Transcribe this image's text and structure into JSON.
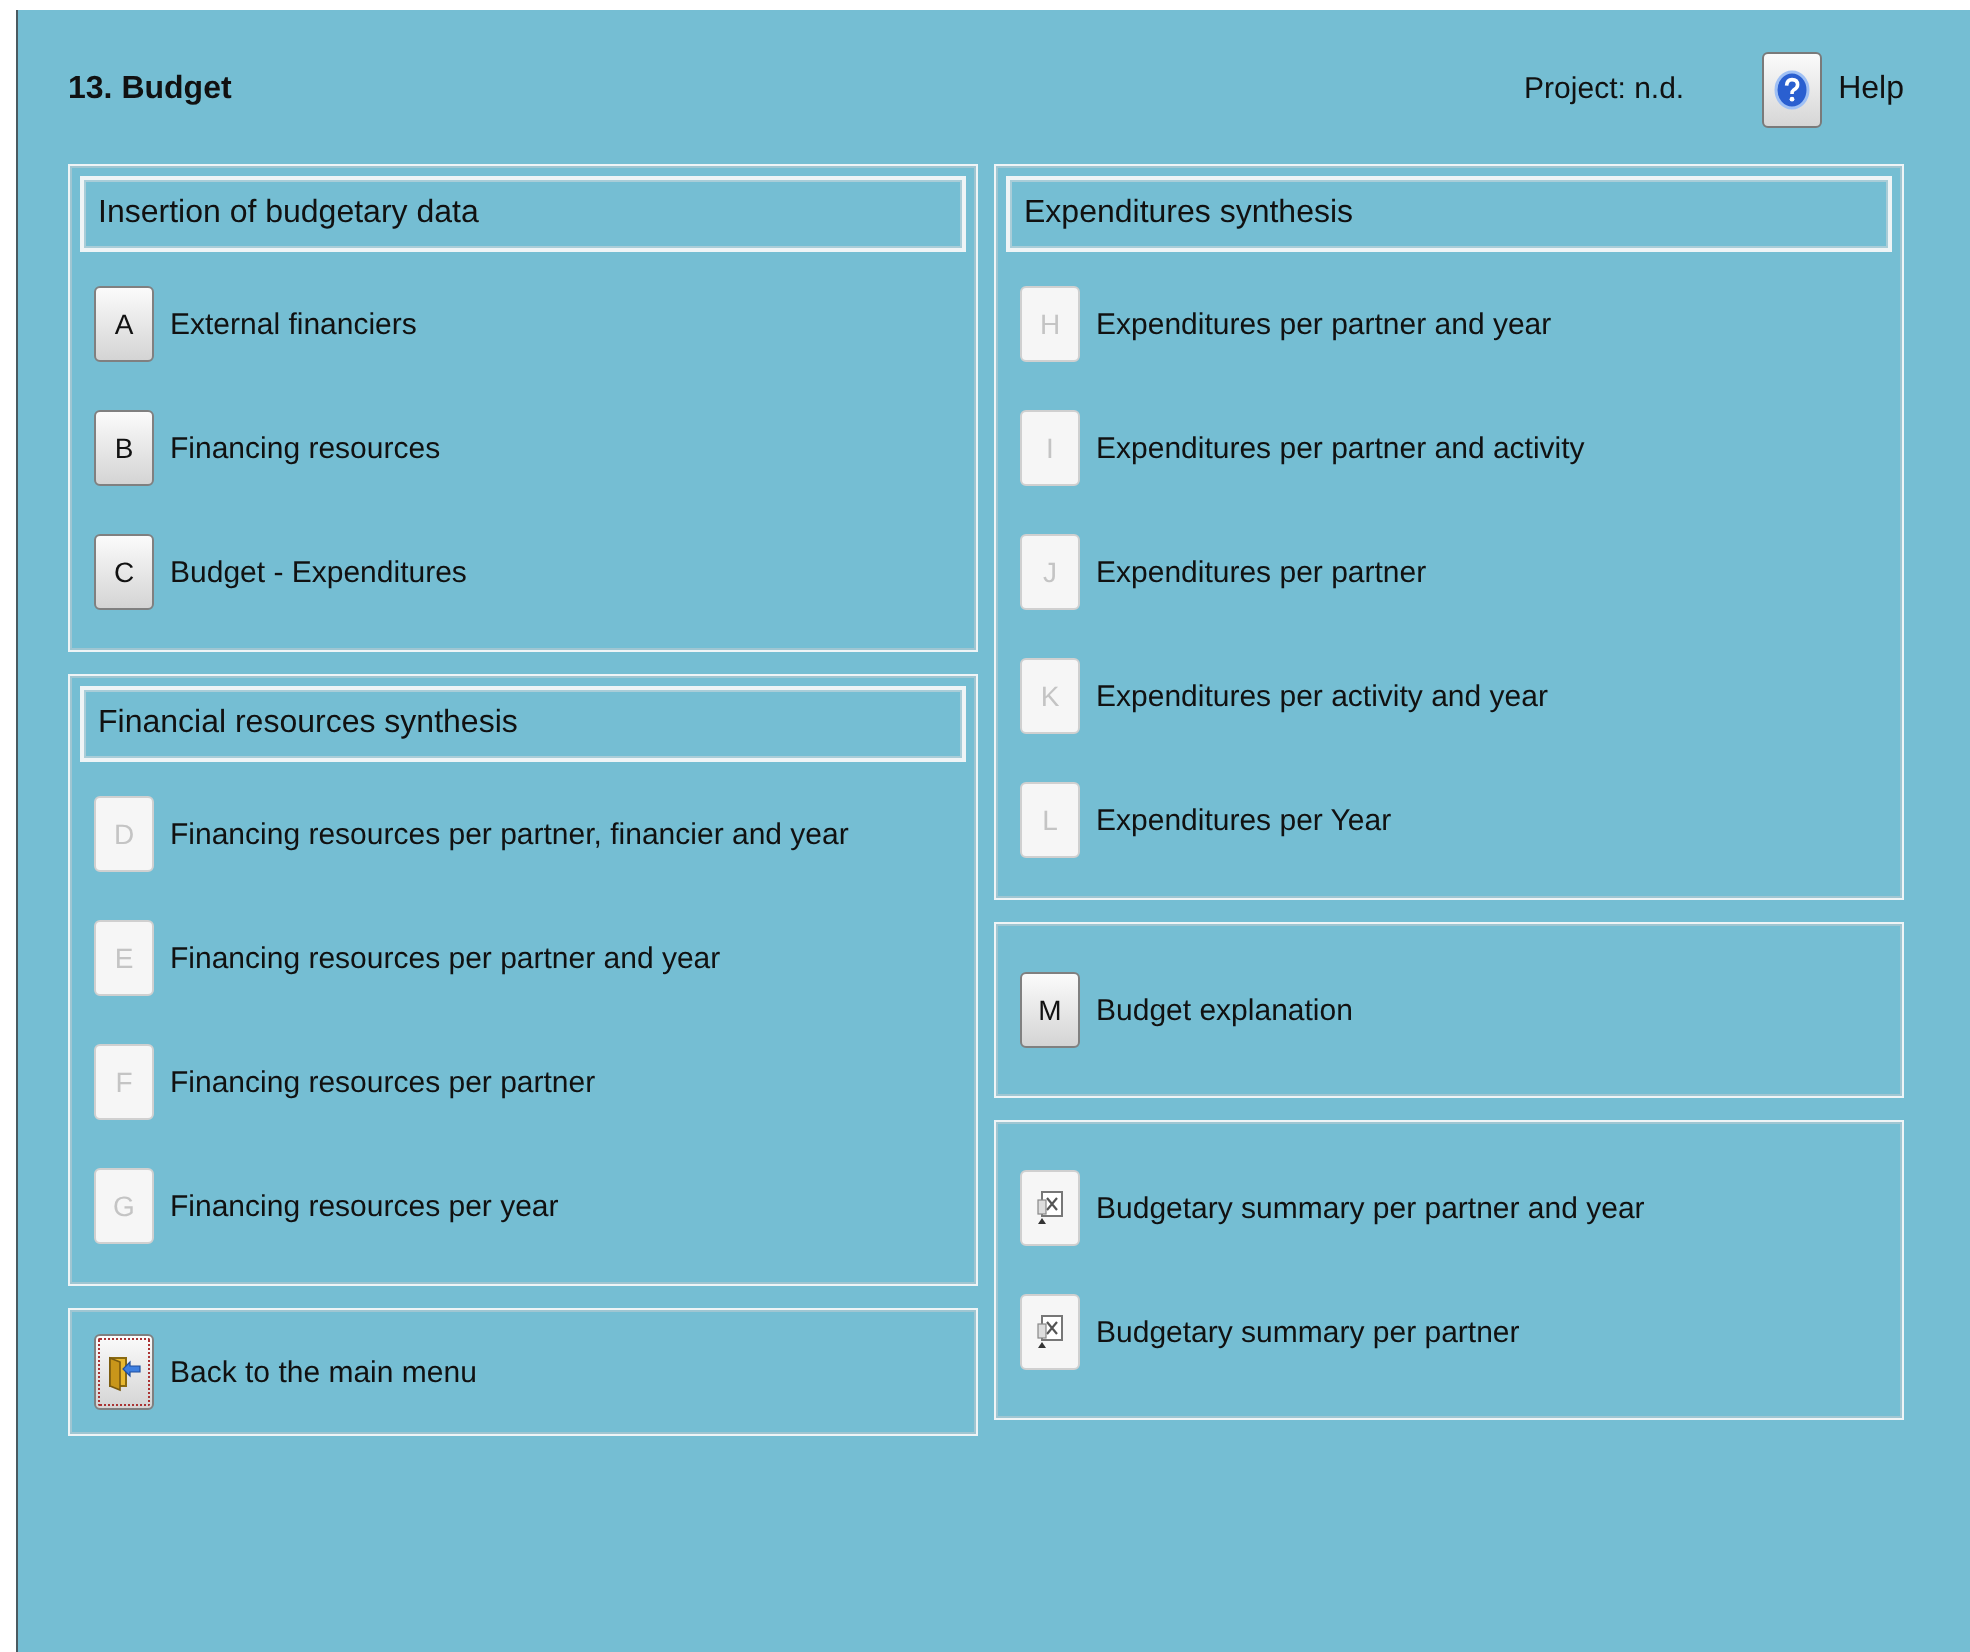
{
  "title": "13. Budget",
  "project": "Project: n.d.",
  "help": {
    "label": "Help"
  },
  "columns": [
    {
      "groups": [
        {
          "header": "Insertion of budgetary data",
          "items": [
            {
              "kind": "letter",
              "key": "A",
              "label": "External financiers",
              "disabled": false
            },
            {
              "kind": "letter",
              "key": "B",
              "label": "Financing resources",
              "disabled": false
            },
            {
              "kind": "letter",
              "key": "C",
              "label": "Budget - Expenditures",
              "disabled": false
            }
          ]
        },
        {
          "header": "Financial resources synthesis",
          "items": [
            {
              "kind": "letter",
              "key": "D",
              "label": "Financing resources per partner, financier and year",
              "disabled": true
            },
            {
              "kind": "letter",
              "key": "E",
              "label": "Financing resources per partner and year",
              "disabled": true
            },
            {
              "kind": "letter",
              "key": "F",
              "label": "Financing resources per partner",
              "disabled": true
            },
            {
              "kind": "letter",
              "key": "G",
              "label": "Financing resources per year",
              "disabled": true
            }
          ]
        },
        {
          "items": [
            {
              "kind": "exit",
              "label": "Back to the main menu",
              "disabled": false,
              "focused": true
            }
          ]
        }
      ]
    },
    {
      "groups": [
        {
          "header": "Expenditures synthesis",
          "items": [
            {
              "kind": "letter",
              "key": "H",
              "label": "Expenditures per partner and year",
              "disabled": true
            },
            {
              "kind": "letter",
              "key": "I",
              "label": "Expenditures per partner and activity",
              "disabled": true
            },
            {
              "kind": "letter",
              "key": "J",
              "label": "Expenditures per partner",
              "disabled": true
            },
            {
              "kind": "letter",
              "key": "K",
              "label": "Expenditures per activity and year",
              "disabled": true
            },
            {
              "kind": "letter",
              "key": "L",
              "label": "Expenditures per Year",
              "disabled": true
            }
          ]
        },
        {
          "items": [
            {
              "kind": "letter",
              "key": "M",
              "label": "Budget explanation",
              "disabled": false
            }
          ]
        },
        {
          "items": [
            {
              "kind": "excel",
              "label": "Budgetary summary per partner and year",
              "disabled": true
            },
            {
              "kind": "excel",
              "label": "Budgetary summary per partner",
              "disabled": true
            }
          ]
        }
      ]
    }
  ]
}
